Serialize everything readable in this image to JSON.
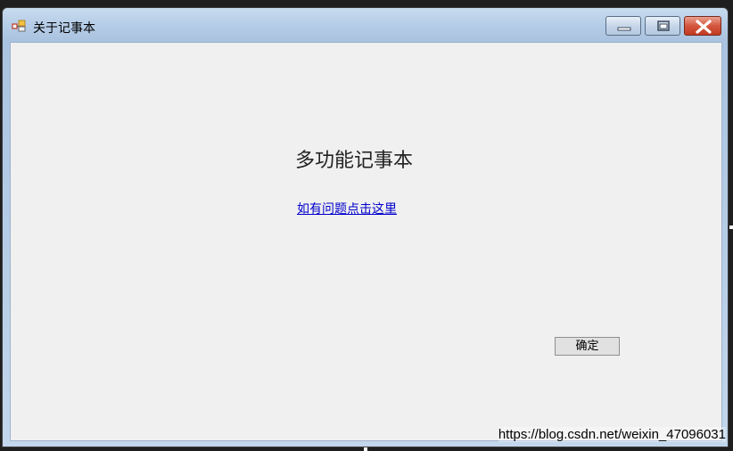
{
  "window": {
    "title": "关于记事本",
    "icon": "app-icon",
    "buttons": {
      "minimize": "minimize-icon",
      "maximize": "maximize-icon",
      "close": "close-icon"
    }
  },
  "content": {
    "heading": "多功能记事本",
    "help_link": "如有问题点击这里",
    "ok_button": "确定"
  },
  "watermark": "https://blog.csdn.net/weixin_47096031",
  "colors": {
    "link": "#0000cc",
    "client_background": "#f0f0f0",
    "close_button": "#c94a33"
  }
}
